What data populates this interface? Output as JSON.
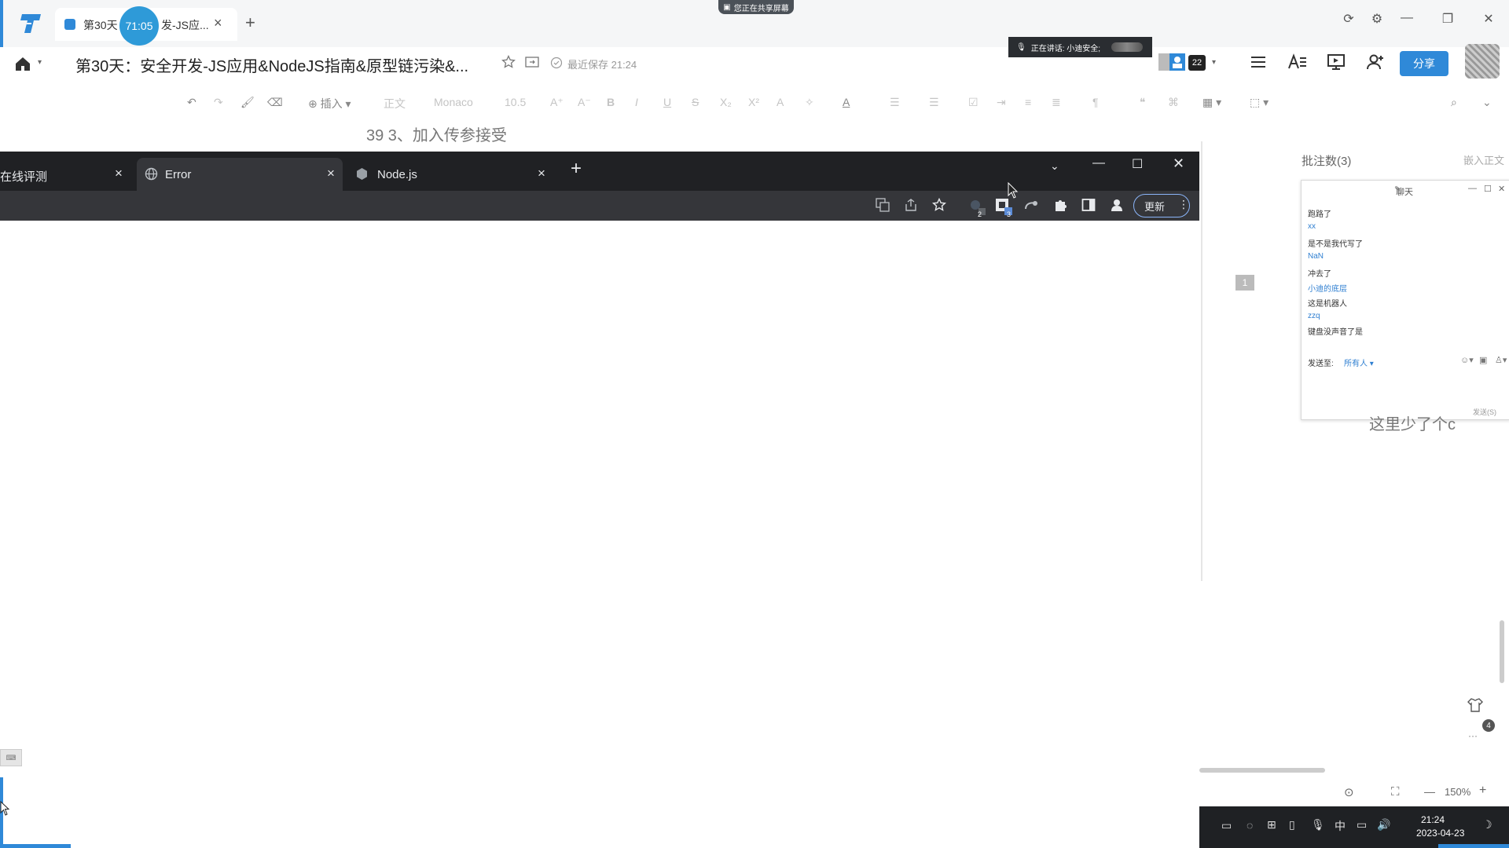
{
  "app": {
    "tab_label": "第30天",
    "tab_label_suffix": "发-JS应...",
    "tab_close": "×",
    "new_tab": "+",
    "timer": "71:05",
    "screen_share": "您正在共享屏幕",
    "window_controls": [
      "⟳",
      "⚙",
      "—",
      "❐",
      "✕"
    ]
  },
  "doc_header": {
    "title": "第30天：安全开发-JS应用&NodeJS指南&原型链污染&...",
    "save_status": "最近保存 21:24",
    "speaker": "正在讲话: 小迪安全;",
    "collab_count": "22",
    "share_label": "分享"
  },
  "toolbar": {
    "insert": "插入",
    "style": "正文",
    "font": "Monaco",
    "size": "10.5"
  },
  "document": {
    "line": "39  3、加入传参接受",
    "comment_bg_text": "这里少了个c"
  },
  "browser": {
    "tabs": [
      {
        "label": "在线评测",
        "close": "×"
      },
      {
        "label": "Error",
        "close": "×"
      },
      {
        "label": "Node.js",
        "close": "×"
      }
    ],
    "new_tab": "+",
    "update_label": "更新",
    "badge_a": "2",
    "badge_b": "3"
  },
  "comments": {
    "count_label": "批注数(3)",
    "insert_body": "嵌入正文",
    "page_number": "1"
  },
  "chat": {
    "title": "聊天",
    "messages": [
      {
        "kind": "text",
        "value": "跑路了"
      },
      {
        "kind": "name",
        "value": "xx"
      },
      {
        "kind": "text",
        "value": "是不是我代写了"
      },
      {
        "kind": "name",
        "value": "NaN"
      },
      {
        "kind": "text",
        "value": "冲去了"
      },
      {
        "kind": "name",
        "value": "小迪的底层"
      },
      {
        "kind": "text",
        "value": "这是机器人"
      },
      {
        "kind": "name",
        "value": "zzq"
      },
      {
        "kind": "text",
        "value": "键盘没声音了是"
      }
    ],
    "send_to_label": "发送至:",
    "send_to_value": "所有人 ▾",
    "send_label": "发送(S)"
  },
  "zoom": {
    "level": "150%",
    "minus": "—",
    "plus": "+"
  },
  "notification_count": "4",
  "taskbar": {
    "ime": "中",
    "time": "21:24",
    "date": "2023-04-23"
  }
}
